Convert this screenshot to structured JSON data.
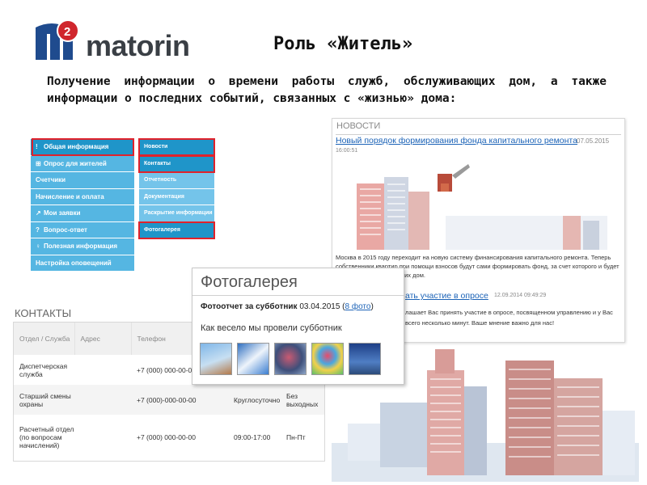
{
  "logo": {
    "text": "matorin"
  },
  "title": "Роль «Житель»",
  "intro": "Получение информации о времени работы служб, обслуживающих дом, а также информации о последних событий, связанных с «жизнью» дома:",
  "menu": {
    "items": [
      {
        "icon": "!",
        "label": "Общая информация"
      },
      {
        "icon": "⊞",
        "label": "Опрос для жителей"
      },
      {
        "icon": "",
        "label": "Счетчики"
      },
      {
        "icon": "",
        "label": "Начисление и оплата"
      },
      {
        "icon": "↗",
        "label": "Мои заявки"
      },
      {
        "icon": "?",
        "label": "Вопрос-ответ"
      },
      {
        "icon": "♀",
        "label": "Полезная информация"
      },
      {
        "icon": "",
        "label": "Настройка оповещений"
      }
    ],
    "sub_items": [
      "Новости",
      "Контакты",
      "Отчетность",
      "Документация",
      "Раскрытие информации",
      "Фотогалерея"
    ]
  },
  "news": {
    "header": "НОВОСТИ",
    "link": "Новый порядок формирования фонда капитального ремонта",
    "date": "07.05.2015",
    "time": "16:00:51",
    "body": "Москва в 2015 году переходит на новую систему финансирования капитального ремонта. Теперь собственники квартир при помощи взносов будут сами формировать фонд, за счет которого и будет проводиться капремонт их дом.",
    "link2": "ать участие в опросе",
    "date2": "12.09.2014 09:49:29",
    "body2": "лашает Вас принять участие в опросе, посвященном управлению и у Вас всего несколько минут. Ваше мнение важно для нас!"
  },
  "gallery": {
    "title": "Фотогалерея",
    "report": "Фотоотчет за субботник",
    "report_date": "03.04.2015",
    "photo_link": "8 фото",
    "description": "Как весело мы провели субботник"
  },
  "contacts": {
    "header": "КОНТАКТЫ",
    "columns": [
      "Отдел / Служба",
      "Адрес",
      "Телефон"
    ],
    "rows": [
      {
        "dept": "Диспетчерская служба",
        "phone": "+7 (000) 000-00-00",
        "hours": "",
        "days": ""
      },
      {
        "dept": "Старший смены охраны",
        "phone": "+7 (000)-000-00-00",
        "hours": "Круглосуточно",
        "days": "Без выходных"
      },
      {
        "dept": "Расчетный отдел (по вопросам начислений)",
        "phone": "+7 (000) 000-00-00",
        "hours": "09:00-17:00",
        "days": "Пн-Пт"
      }
    ]
  },
  "colors": {
    "menu_bg": "#55b6e2",
    "menu_active": "#1f95c9",
    "highlight": "#e0222b",
    "link": "#1c63b7",
    "logo_blue": "#1f4b8e",
    "logo_red": "#d0262d"
  }
}
